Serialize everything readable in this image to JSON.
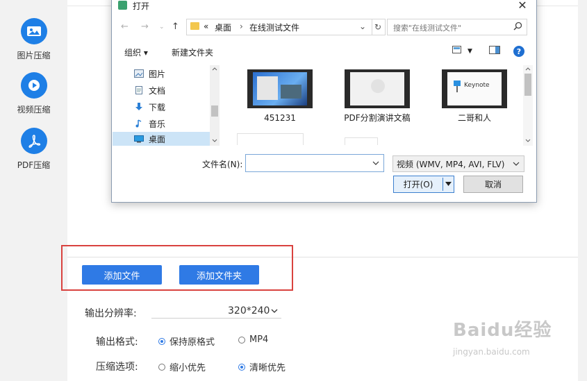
{
  "sidebar": {
    "items": [
      {
        "label": "图片压缩",
        "icon": "image-icon"
      },
      {
        "label": "视频压缩",
        "icon": "play-icon"
      },
      {
        "label": "PDF压缩",
        "icon": "pdf-icon"
      }
    ]
  },
  "dialog": {
    "title": "打开",
    "address": {
      "prefix": "«",
      "parts": [
        "桌面",
        "在线测试文件"
      ]
    },
    "search_placeholder": "搜索\"在线测试文件\"",
    "toolbar": {
      "organize": "组织 ▾",
      "new_folder": "新建文件夹"
    },
    "tree_items": [
      "图片",
      "文档",
      "下载",
      "音乐",
      "桌面"
    ],
    "files": [
      {
        "name": "451231"
      },
      {
        "name": "PDF分割演讲文稿"
      },
      {
        "name": "二哥和人"
      }
    ],
    "keynote_label": "Keynote",
    "filename_label": "文件名(N):",
    "filename_value": "",
    "file_type": "视频 (WMV, MP4, AVI, FLV)",
    "open_button": "打开(O)",
    "cancel_button": "取消"
  },
  "main": {
    "add_file_button": "添加文件",
    "add_folder_button": "添加文件夹",
    "resolution_label": "输出分辨率:",
    "resolution_value": "320*240",
    "format_label": "输出格式:",
    "format_options": [
      {
        "label": "保持原格式",
        "selected": true
      },
      {
        "label": "MP4",
        "selected": false
      }
    ],
    "compress_label": "压缩选项:",
    "compress_options": [
      {
        "label": "缩小优先",
        "selected": false
      },
      {
        "label": "清晰优先",
        "selected": true
      }
    ]
  },
  "watermark": {
    "brand": "Baidu经验",
    "url": "jingyan.baidu.com"
  },
  "colors": {
    "accent": "#2f7ae5",
    "highlight": "#d9423f"
  }
}
